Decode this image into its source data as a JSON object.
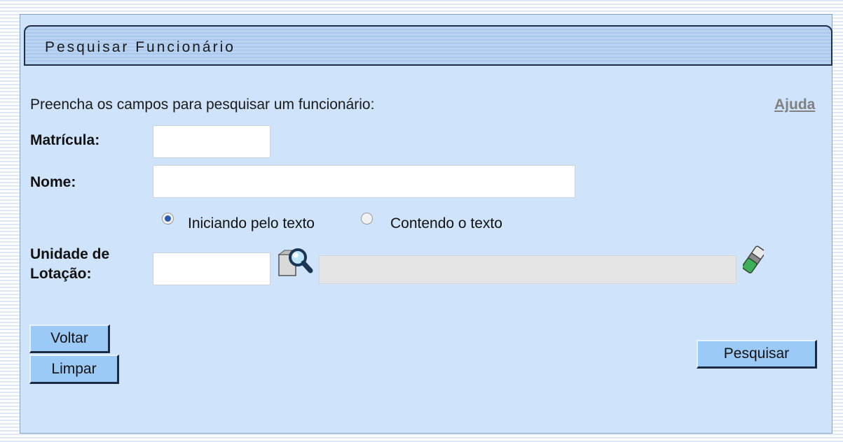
{
  "header": {
    "title": "Pesquisar Funcionário"
  },
  "form": {
    "instruction": "Preencha os campos para pesquisar um funcionário:",
    "help_link": "Ajuda",
    "matricula": {
      "label": "Matrícula:",
      "value": ""
    },
    "nome": {
      "label": "Nome:",
      "value": ""
    },
    "match_options": [
      {
        "label": "Iniciando pelo texto",
        "selected": true
      },
      {
        "label": "Contendo o texto",
        "selected": false
      }
    ],
    "unidade": {
      "label_line1": "Unidade de",
      "label_line2": "Lotação:",
      "code_value": "",
      "description_value": ""
    }
  },
  "buttons": {
    "voltar": "Voltar",
    "limpar": "Limpar",
    "pesquisar": "Pesquisar"
  },
  "icons": {
    "search": "magnifier-search-icon",
    "clear": "eraser-icon"
  },
  "colors": {
    "panel_background": "#cfe4fb",
    "button_background": "#9ccaf7",
    "help_link": "#808080"
  }
}
